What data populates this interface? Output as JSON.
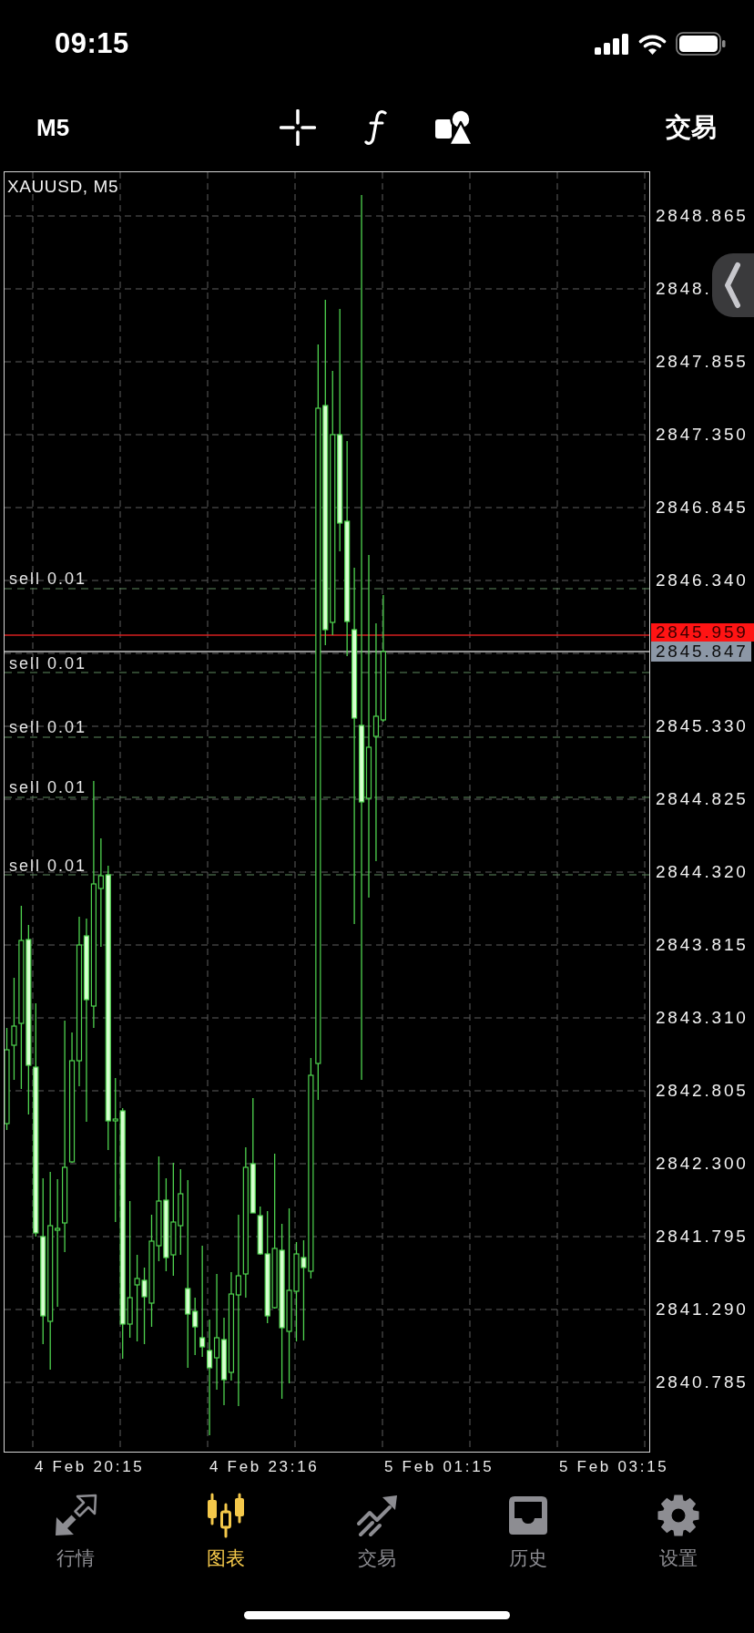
{
  "status_bar": {
    "time": "09:15"
  },
  "toolbar": {
    "timeframe": "M5",
    "trade_button": "交易"
  },
  "chart": {
    "title": "XAUUSD, M5",
    "orders": [
      {
        "label": "sell 0.01"
      },
      {
        "label": "sell 0.01"
      },
      {
        "label": "sell 0.01"
      },
      {
        "label": "sell 0.01"
      },
      {
        "label": "sell 0.01"
      }
    ],
    "price_axis": [
      "2848.865",
      "2848.",
      "2847.855",
      "2847.350",
      "2846.845",
      "2846.340",
      "2845.330",
      "2844.825",
      "2844.320",
      "2843.815",
      "2843.310",
      "2842.805",
      "2842.300",
      "2841.795",
      "2841.290",
      "2840.785"
    ],
    "price_tags": [
      {
        "kind": "ask",
        "value": "2845.959"
      },
      {
        "kind": "bid",
        "value": "2845.847"
      }
    ],
    "time_axis": [
      "4 Feb 20:15",
      "4 Feb 23:16",
      "5 Feb 01:15",
      "5 Feb 03:15"
    ]
  },
  "tab_bar": [
    {
      "label": "行情",
      "selected": false
    },
    {
      "label": "图表",
      "selected": true
    },
    {
      "label": "交易",
      "selected": false
    },
    {
      "label": "历史",
      "selected": false
    },
    {
      "label": "设置",
      "selected": false
    }
  ]
}
